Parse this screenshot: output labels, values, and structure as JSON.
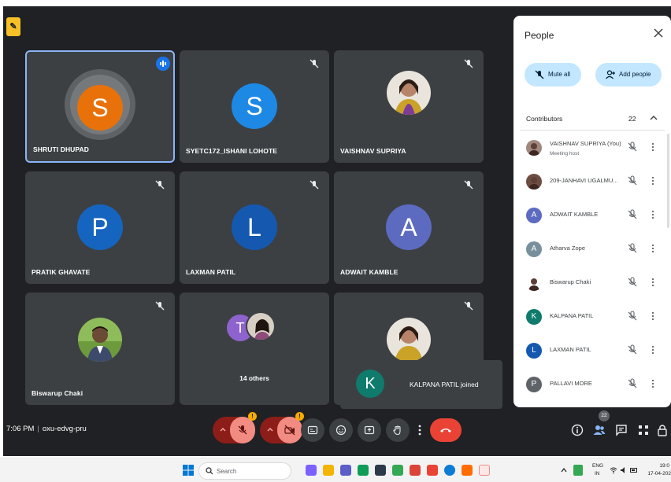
{
  "meeting": {
    "code": "oxu-edvg-pru",
    "time": "7:06 PM",
    "join_toast": "KALPANA PATIL joined",
    "join_toast_initial": "K"
  },
  "tiles": [
    {
      "name": "SHRUTI DHUPAD",
      "initial": "S",
      "color": "#e8710a",
      "speaking": true
    },
    {
      "name": "SYETC172_ISHANI LOHOTE",
      "initial": "S",
      "color": "#1e88e5"
    },
    {
      "name": "VAISHNAV SUPRIYA",
      "photo": true
    },
    {
      "name": "PRATIK GHAVATE",
      "initial": "P",
      "color": "#1565c0"
    },
    {
      "name": "LAXMAN PATIL",
      "initial": "L",
      "color": "#1558b0"
    },
    {
      "name": "ADWAIT KAMBLE",
      "initial": "A",
      "color": "#5c6bc0"
    },
    {
      "name": "Biswarup Chaki",
      "photo": true
    },
    {
      "name": "14 others",
      "initial": "T",
      "color": "#8e63ce"
    },
    {
      "name": "",
      "photo": true
    }
  ],
  "people_panel": {
    "title": "People",
    "mute_all": "Mute all",
    "add_people": "Add people",
    "section": "Contributors",
    "count": "22",
    "participants": [
      {
        "name": "VAISHNAV SUPRIYA (You)",
        "sub": "Meeting host",
        "initial": "",
        "color": "#a1887f"
      },
      {
        "name": "209-JANHAVI UGALMU...",
        "sub": "",
        "initial": "",
        "color": "#6d4c41"
      },
      {
        "name": "ADWAIT KAMBLE",
        "sub": "",
        "initial": "A",
        "color": "#5c6bc0"
      },
      {
        "name": "Atharva Zope",
        "sub": "",
        "initial": "A",
        "color": "#78909c"
      },
      {
        "name": "Biswarup Chaki",
        "sub": "",
        "initial": "",
        "color": "#ffffff"
      },
      {
        "name": "KALPANA PATIL",
        "sub": "",
        "initial": "K",
        "color": "#0f7b6c"
      },
      {
        "name": "LAXMAN PATIL",
        "sub": "",
        "initial": "L",
        "color": "#1558b0"
      },
      {
        "name": "PALLAVI MORE",
        "sub": "",
        "initial": "P",
        "color": "#5f6368"
      }
    ]
  },
  "people_badge": "22",
  "taskbar": {
    "search_placeholder": "Search",
    "lang": "ENG",
    "region": "IN",
    "clock_time": "19:0",
    "clock_date": "17-04-202"
  },
  "colors": {
    "meet_bg": "#202124",
    "tile_bg": "#3c4043",
    "accent": "#8ab4f8",
    "end_call": "#ea4335",
    "mic_off": "#f28b82"
  }
}
